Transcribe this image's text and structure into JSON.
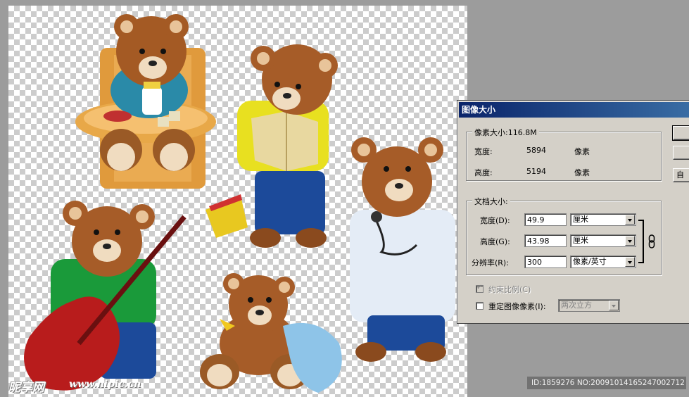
{
  "watermark": {
    "logo": "昵享网",
    "url": "www.nipic.cn",
    "id_line": "ID:1859276 NO:20091014165247002712"
  },
  "dialog": {
    "title": "图像大小",
    "pixel_dimensions": {
      "heading": "像素大小:116.8M",
      "width_label": "宽度:",
      "width_value": "5894",
      "width_unit": "像素",
      "height_label": "高度:",
      "height_value": "5194",
      "height_unit": "像素"
    },
    "document_size": {
      "heading": "文档大小:",
      "width_label": "宽度(D):",
      "width_value": "49.9",
      "width_unit": "厘米",
      "height_label": "高度(G):",
      "height_value": "43.98",
      "height_unit": "厘米",
      "resolution_label": "分辨率(R):",
      "resolution_value": "300",
      "resolution_unit": "像素/英寸"
    },
    "constrain_label": "约束比例(C)",
    "constrain_checked": true,
    "resample_label": "重定图像像素(I):",
    "resample_checked": false,
    "resample_method": "两次立方",
    "buttons": {
      "ok": "",
      "cancel": "",
      "auto": "自"
    }
  },
  "colors": {
    "titlebar_start": "#0a246a",
    "titlebar_end": "#3a6ea5",
    "dialog_face": "#d4d0c8"
  }
}
